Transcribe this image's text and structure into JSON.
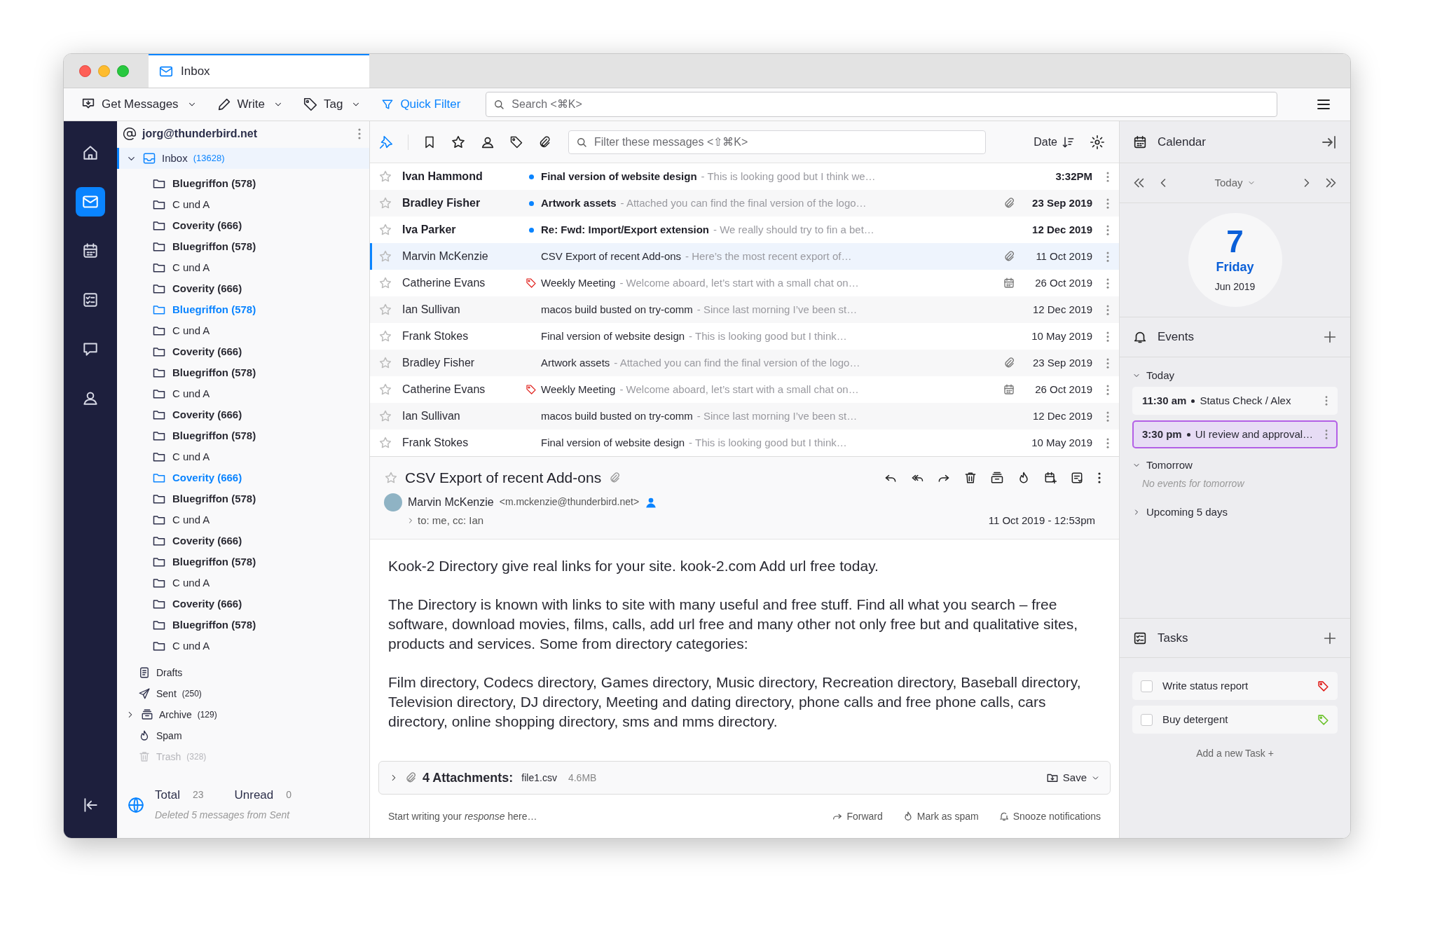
{
  "window": {
    "tabs": [
      {
        "label": "Inbox",
        "selected": true
      }
    ]
  },
  "toolbar": {
    "buttons": [
      {
        "label": "Get Messages",
        "kind": "get"
      },
      {
        "label": "Write",
        "kind": "write"
      },
      {
        "label": "Tag",
        "kind": "tag"
      }
    ],
    "quick_filter": "Quick Filter",
    "search": {
      "placeholder": "Search <⌘K>"
    }
  },
  "spaces": [
    {
      "kind": "home",
      "selected": false
    },
    {
      "kind": "mail",
      "selected": true
    },
    {
      "kind": "calendar",
      "selected": false
    },
    {
      "kind": "tasks",
      "selected": false
    },
    {
      "kind": "chat",
      "selected": false
    },
    {
      "kind": "contacts",
      "selected": false
    }
  ],
  "folder_pane": {
    "account": "jorg@thunderbird.net",
    "inbox": {
      "label": "Inbox",
      "count": "(13628)",
      "expanded": true,
      "selected": true
    },
    "folders": [
      {
        "label": "Bluegriffon (578)",
        "unread": true,
        "highlighted": false
      },
      {
        "label": "C und A",
        "unread": false,
        "highlighted": false
      },
      {
        "label": "Coverity (666)",
        "unread": true,
        "highlighted": false
      },
      {
        "label": "Bluegriffon (578)",
        "unread": true,
        "highlighted": false
      },
      {
        "label": "C und A",
        "unread": false,
        "highlighted": false
      },
      {
        "label": "Coverity (666)",
        "unread": true,
        "highlighted": false
      },
      {
        "label": "Bluegriffon (578)",
        "unread": true,
        "highlighted": true
      },
      {
        "label": "C und A",
        "unread": false,
        "highlighted": false
      },
      {
        "label": "Coverity (666)",
        "unread": true,
        "highlighted": false
      },
      {
        "label": "Bluegriffon (578)",
        "unread": true,
        "highlighted": false
      },
      {
        "label": "C und A",
        "unread": false,
        "highlighted": false
      },
      {
        "label": "Coverity (666)",
        "unread": true,
        "highlighted": false
      },
      {
        "label": "Bluegriffon (578)",
        "unread": true,
        "highlighted": false
      },
      {
        "label": "C und A",
        "unread": false,
        "highlighted": false
      },
      {
        "label": "Coverity (666)",
        "unread": true,
        "highlighted": true
      },
      {
        "label": "Bluegriffon (578)",
        "unread": true,
        "highlighted": false
      },
      {
        "label": "C und A",
        "unread": false,
        "highlighted": false
      },
      {
        "label": "Coverity (666)",
        "unread": true,
        "highlighted": false
      },
      {
        "label": "Bluegriffon (578)",
        "unread": true,
        "highlighted": false
      },
      {
        "label": "C und A",
        "unread": false,
        "highlighted": false
      },
      {
        "label": "Coverity (666)",
        "unread": true,
        "highlighted": false
      },
      {
        "label": "Bluegriffon (578)",
        "unread": true,
        "highlighted": false
      },
      {
        "label": "C und A",
        "unread": false,
        "highlighted": false
      }
    ],
    "special_folders": [
      {
        "kind": "drafts",
        "label": "Drafts",
        "disabled": false
      },
      {
        "kind": "sent",
        "label": "Sent",
        "count": "(250)",
        "disabled": false
      },
      {
        "kind": "archive",
        "label": "Archive",
        "count": "(129)",
        "expanded": false,
        "disabled": false
      },
      {
        "kind": "spam",
        "label": "Spam",
        "disabled": false
      },
      {
        "kind": "trash",
        "label": "Trash",
        "count": "(328)",
        "disabled": true
      }
    ],
    "footer": {
      "total_label": "Total",
      "total": "23",
      "unread_label": "Unread",
      "unread": "0",
      "status": "Deleted 5 messages from Sent"
    }
  },
  "message_list": {
    "filter": {
      "placeholder": "Filter these messages <⇧⌘K>"
    },
    "sort_label": "Date",
    "rows": [
      {
        "sender": "Ivan Hammond",
        "subject": "Final version of website design",
        "preview": "- This is looking good but I think we…",
        "date": "3:32PM",
        "unread": true,
        "selected": false,
        "starred": false,
        "tagged": false,
        "attachment": false,
        "invitation": false
      },
      {
        "sender": "Bradley Fisher",
        "subject": "Artwork assets",
        "preview": "- Attached you can find the final version of the logo…",
        "date": "23 Sep 2019",
        "unread": true,
        "selected": false,
        "starred": false,
        "tagged": false,
        "attachment": true,
        "invitation": false
      },
      {
        "sender": "Iva Parker",
        "subject": "Re: Fwd: Import/Export extension",
        "preview": "- We really should try to fin a bet…",
        "date": "12 Dec 2019",
        "unread": true,
        "selected": false,
        "starred": false,
        "tagged": false,
        "attachment": false,
        "invitation": false
      },
      {
        "sender": "Marvin McKenzie",
        "subject": "CSV Export of recent Add-ons",
        "preview": "- Here’s the most recent export of…",
        "date": "11 Oct 2019",
        "unread": false,
        "selected": true,
        "starred": false,
        "tagged": false,
        "attachment": true,
        "invitation": false
      },
      {
        "sender": "Catherine Evans",
        "subject": "Weekly Meeting",
        "preview": "- Welcome aboard, let’s start with a small chat on…",
        "date": "26 Oct 2019",
        "unread": false,
        "selected": false,
        "starred": false,
        "tagged": true,
        "attachment": false,
        "invitation": true
      },
      {
        "sender": "Ian Sullivan",
        "subject": "macos build busted on try-comm",
        "preview": "- Since last morning I’ve been st…",
        "date": "12 Dec 2019",
        "unread": false,
        "selected": false,
        "starred": false,
        "tagged": false,
        "attachment": false,
        "invitation": false
      },
      {
        "sender": "Frank Stokes",
        "subject": "Final version of website design",
        "preview": "- This is looking good but I think…",
        "date": "10 May 2019",
        "unread": false,
        "selected": false,
        "starred": false,
        "tagged": false,
        "attachment": false,
        "invitation": false
      },
      {
        "sender": "Bradley Fisher",
        "subject": "Artwork assets",
        "preview": "- Attached you can find the final version of the logo…",
        "date": "23 Sep 2019",
        "unread": false,
        "selected": false,
        "starred": false,
        "tagged": false,
        "attachment": true,
        "invitation": false
      },
      {
        "sender": "Catherine Evans",
        "subject": "Weekly Meeting",
        "preview": "- Welcome aboard, let’s start with a small chat on…",
        "date": "26 Oct 2019",
        "unread": false,
        "selected": false,
        "starred": false,
        "tagged": true,
        "attachment": false,
        "invitation": true
      },
      {
        "sender": "Ian Sullivan",
        "subject": "macos build busted on try-comm",
        "preview": "- Since last morning I’ve been st…",
        "date": "12 Dec 2019",
        "unread": false,
        "selected": false,
        "starred": false,
        "tagged": false,
        "attachment": false,
        "invitation": false
      },
      {
        "sender": "Frank Stokes",
        "subject": "Final version of website design",
        "preview": "- This is looking good but I think…",
        "date": "10 May 2019",
        "unread": false,
        "selected": false,
        "starred": false,
        "tagged": false,
        "attachment": false,
        "invitation": false
      }
    ]
  },
  "reading_pane": {
    "subject": "CSV Export of recent Add-ons",
    "starred": false,
    "sender": "Marvin McKenzie",
    "email": "<m.mckenzie@thunderbird.net>",
    "recipients": "to: me, cc: Ian",
    "date": "11 Oct 2019 - 12:53pm",
    "body": [
      "Kook-2 Directory give real links for your site. kook-2.com  Add url free today.",
      "The Directory is known with links to site with many useful and free stuff. Find all what you search – free software, download movies, films, calls, add url free and many other not only free but and qualitative sites, products and services. Some from directory categories:",
      "Film directory, Codecs directory, Games directory, Music directory, Recreation directory, Baseball directory, Television directory, DJ directory, Meeting and dating directory, phone calls and free phone calls, cars directory, online shopping directory, sms and mms directory."
    ],
    "attachments": {
      "label": "4 Attachments:",
      "file": "file1.csv",
      "size": "4.6MB",
      "save": "Save"
    },
    "reply_placeholder": "Start writing your *response* here…",
    "actions": [
      {
        "kind": "forward",
        "label": "Forward"
      },
      {
        "kind": "spam",
        "label": "Mark as spam"
      },
      {
        "kind": "snooze",
        "label": "Snooze notifications"
      }
    ]
  },
  "calendar": {
    "title": "Calendar",
    "nav_label": "Today",
    "day": "7",
    "weekday": "Friday",
    "month": "Jun 2019",
    "events_title": "Events",
    "groups": [
      {
        "label": "Today",
        "expanded": true,
        "events": [
          {
            "time": "11:30 am",
            "title": "Status Check / Alex",
            "selected": false
          },
          {
            "time": "3:30 pm",
            "title": "UI review and approval…",
            "selected": true
          }
        ]
      },
      {
        "label": "Tomorrow",
        "expanded": true,
        "empty_text": "No events for tomorrow"
      },
      {
        "label": "Upcoming 5 days",
        "expanded": false
      }
    ],
    "tasks_title": "Tasks",
    "tasks": [
      {
        "label": "Write status report",
        "checked": false,
        "color": "#e0201c"
      },
      {
        "label": "Buy detergent",
        "checked": false,
        "color": "#6cc22c"
      }
    ],
    "add_task": "Add a new Task +"
  }
}
